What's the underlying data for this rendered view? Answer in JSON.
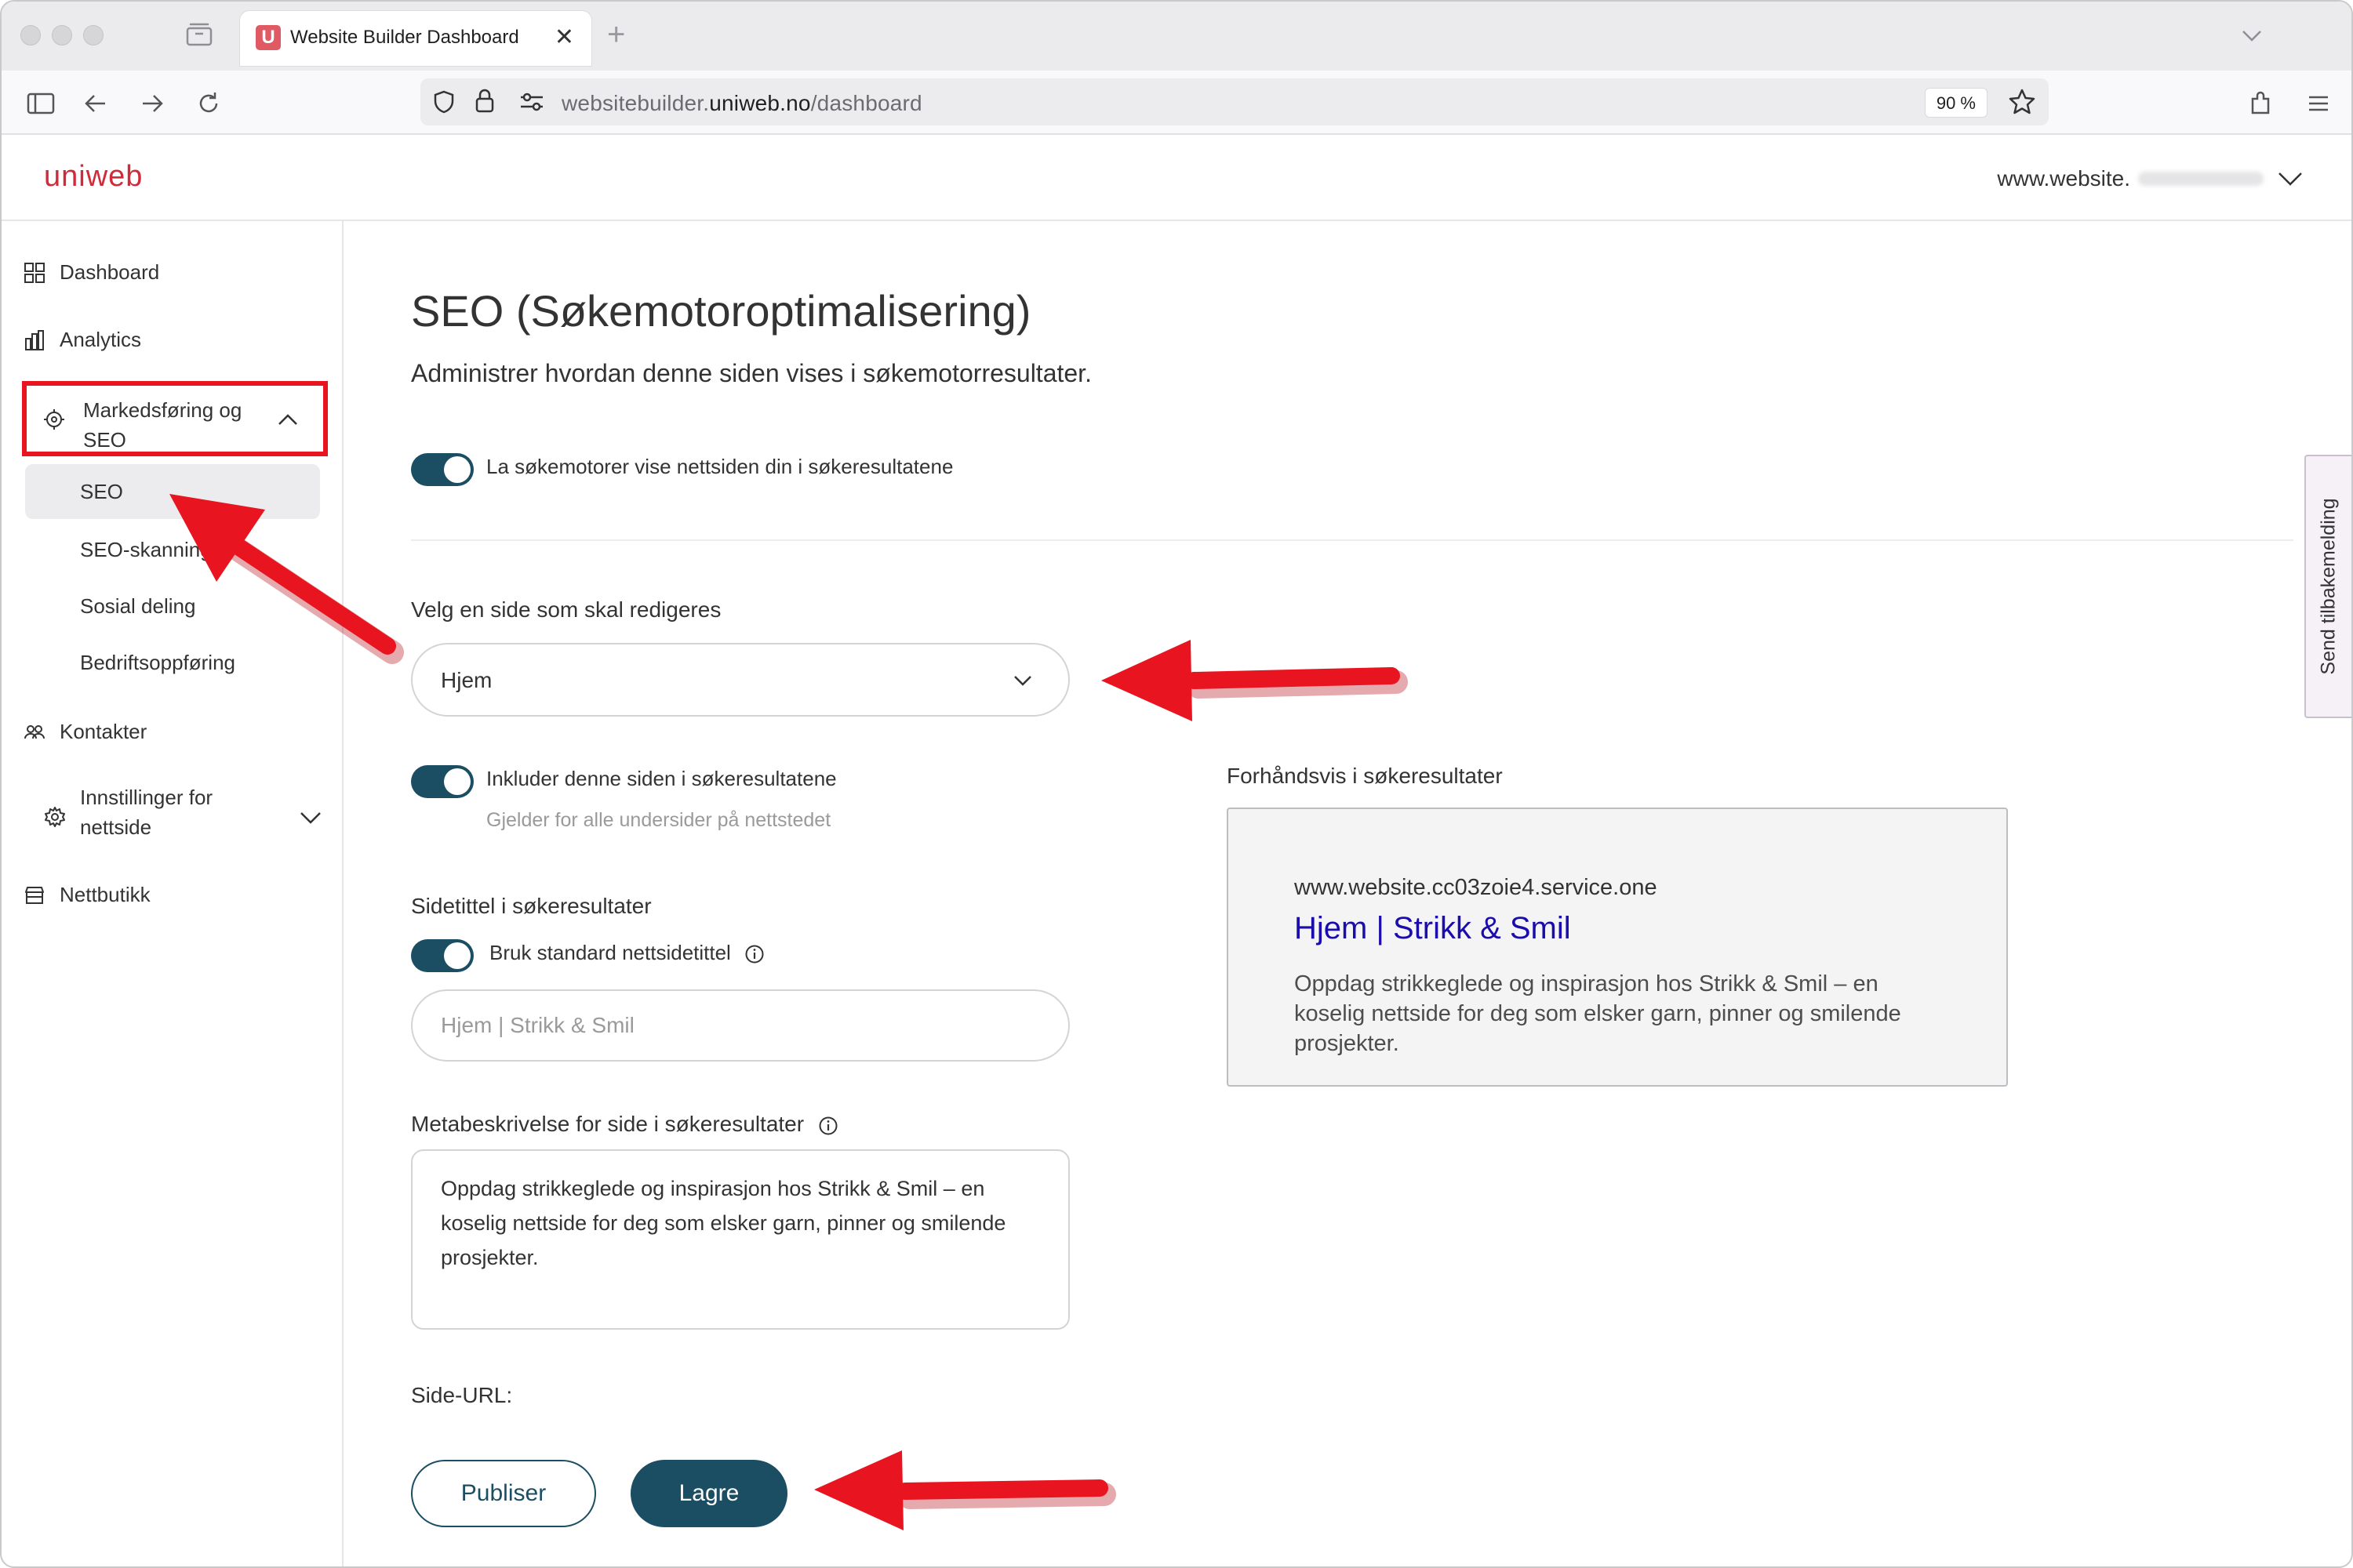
{
  "browser": {
    "tab_title": "Website Builder Dashboard",
    "tab_favicon": "U",
    "url_prefix": "websitebuilder.",
    "url_domain": "uniweb.no",
    "url_path": "/dashboard",
    "zoom": "90 %"
  },
  "header": {
    "logo": "uniweb",
    "site_selector": "www.website."
  },
  "sidebar": {
    "dashboard": "Dashboard",
    "analytics": "Analytics",
    "marketing": "Markedsføring og SEO",
    "seo": "SEO",
    "seo_scan": "SEO-skanning",
    "social": "Sosial deling",
    "business": "Bedriftsoppføring",
    "contacts": "Kontakter",
    "site_settings": "Innstillinger for nettside",
    "shop": "Nettbutikk"
  },
  "main": {
    "title": "SEO (Søkemotoroptimalisering)",
    "subtitle": "Administrer hvordan denne siden vises i søkemotorresultater.",
    "allow_indexing_label": "La søkemotorer vise nettsiden din i søkeresultatene",
    "page_select_label": "Velg en side som skal redigeres",
    "page_select_value": "Hjem",
    "include_page_label": "Inkluder denne siden i søkeresultatene",
    "include_page_hint": "Gjelder for alle undersider på nettstedet",
    "page_title_label": "Sidetittel i søkeresultater",
    "use_default_title_label": "Bruk standard nettsidetittel",
    "page_title_placeholder": "Hjem | Strikk & Smil",
    "meta_label": "Metabeskrivelse for side i søkeresultater",
    "meta_value": "Oppdag strikkeglede og inspirasjon hos Strikk & Smil – en koselig nettside for deg som elsker garn, pinner og smilende prosjekter.",
    "page_url_label": "Side-URL:",
    "publish_button": "Publiser",
    "save_button": "Lagre"
  },
  "preview": {
    "label": "Forhåndsvis i søkeresultater",
    "url": "www.website.cc03zoie4.service.one",
    "title": "Hjem | Strikk & Smil",
    "description": "Oppdag strikkeglede og inspirasjon hos Strikk & Smil – en koselig nettside for deg som elsker garn, pinner og smilende prosjekter."
  },
  "feedback_tab": "Send tilbakemelding",
  "colors": {
    "brand_red": "#cf2b3a",
    "primary": "#1b4d63",
    "annotation_red": "#e8141f",
    "preview_link": "#1a0dab"
  }
}
